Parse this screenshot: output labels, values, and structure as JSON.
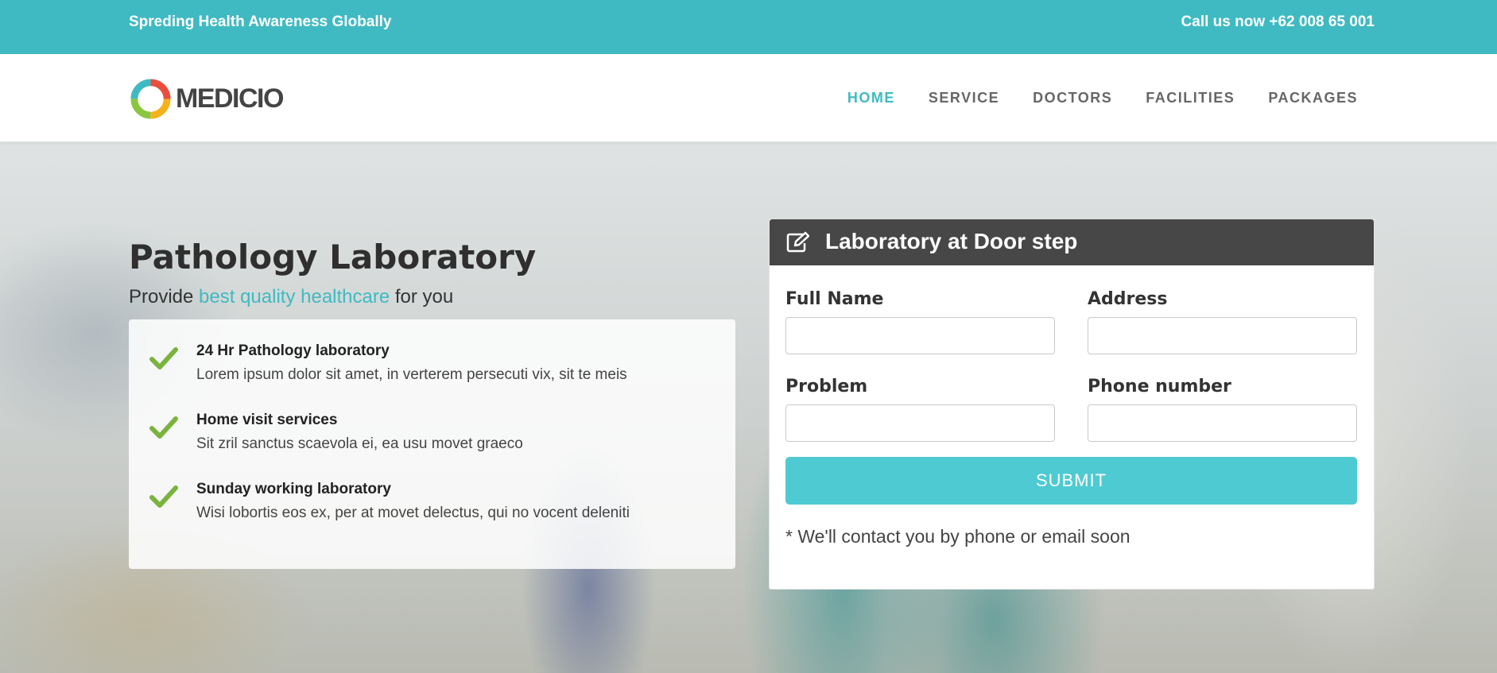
{
  "topbar": {
    "tagline": "Spreding Health Awareness Globally",
    "contact": "Call us now +62 008 65 001"
  },
  "header": {
    "logo_text": "MEDICIO",
    "nav": [
      {
        "label": "HOME",
        "active": true
      },
      {
        "label": "SERVICE",
        "active": false
      },
      {
        "label": "DOCTORS",
        "active": false
      },
      {
        "label": "FACILITIES",
        "active": false
      },
      {
        "label": "PACKAGES",
        "active": false
      }
    ]
  },
  "hero": {
    "title": "Pathology Laboratory",
    "subtitle_pre": "Provide ",
    "subtitle_highlight": "best quality healthcare",
    "subtitle_post": " for you",
    "features": [
      {
        "title": "24 Hr Pathology laboratory",
        "desc": "Lorem ipsum dolor sit amet, in verterem persecuti vix, sit te meis"
      },
      {
        "title": "Home visit services",
        "desc": "Sit zril sanctus scaevola ei, ea usu movet graeco"
      },
      {
        "title": "Sunday working laboratory",
        "desc": "Wisi lobortis eos ex, per at movet delectus, qui no vocent deleniti"
      }
    ]
  },
  "form": {
    "title": "Laboratory at Door step",
    "icon": "edit-icon",
    "fields": {
      "full_name": {
        "label": "Full Name",
        "value": ""
      },
      "address": {
        "label": "Address",
        "value": ""
      },
      "problem": {
        "label": "Problem",
        "value": ""
      },
      "phone": {
        "label": "Phone number",
        "value": ""
      }
    },
    "submit_label": "SUBMIT",
    "note": "* We'll contact you by phone or email soon"
  },
  "colors": {
    "accent": "#3fbac2",
    "button": "#4ecad2",
    "form_header": "#474747",
    "check": "#7ab33e"
  }
}
